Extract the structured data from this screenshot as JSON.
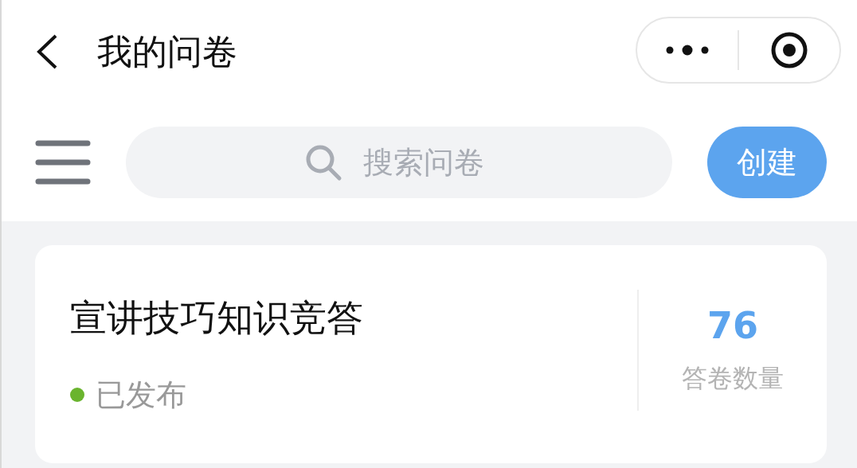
{
  "header": {
    "title": "我的问卷"
  },
  "toolbar": {
    "search": {
      "placeholder": "搜索问卷"
    },
    "create_button": "创建"
  },
  "surveys": [
    {
      "title": "宣讲技巧知识竞答",
      "status": {
        "label": "已发布",
        "color": "#6ab42e"
      },
      "count": "76",
      "count_label": "答卷数量"
    }
  ]
}
